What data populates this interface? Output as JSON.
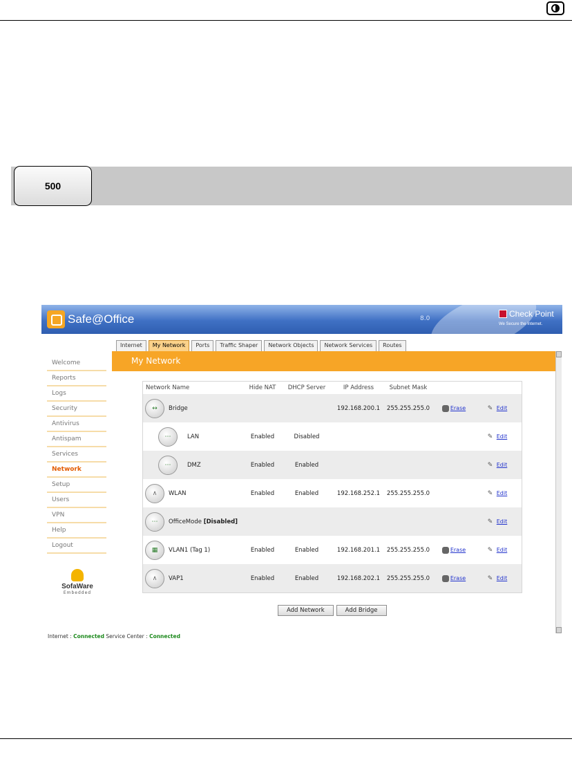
{
  "badge": "500",
  "app": {
    "logo_text": "Safe@Office",
    "version": "8.0",
    "checkpoint_name": "Check Point",
    "checkpoint_tagline": "We Secure the Internet."
  },
  "sidebar": {
    "items": [
      {
        "label": "Welcome"
      },
      {
        "label": "Reports"
      },
      {
        "label": "Logs"
      },
      {
        "label": "Security"
      },
      {
        "label": "Antivirus"
      },
      {
        "label": "Antispam"
      },
      {
        "label": "Services"
      },
      {
        "label": "Network",
        "active": true
      },
      {
        "label": "Setup"
      },
      {
        "label": "Users"
      },
      {
        "label": "VPN"
      },
      {
        "label": "Help"
      },
      {
        "label": "Logout"
      }
    ],
    "brand": "SofaWare",
    "brand_sub": "Embedded"
  },
  "tabs": [
    "Internet",
    "My Network",
    "Ports",
    "Traffic Shaper",
    "Network Objects",
    "Network Services",
    "Routes"
  ],
  "active_tab": "My Network",
  "page_title": "My Network",
  "table": {
    "headers": {
      "name": "Network Name",
      "nat": "Hide NAT",
      "dhcp": "DHCP Server",
      "ip": "IP Address",
      "mask": "Subnet Mask"
    },
    "rows": [
      {
        "name": "Bridge",
        "nat": "",
        "dhcp": "",
        "ip": "192.168.200.1",
        "mask": "255.255.255.0",
        "erase": "Erase",
        "edit": "Edit"
      },
      {
        "name": "LAN",
        "nat": "Enabled",
        "dhcp": "Disabled",
        "ip": "",
        "mask": "",
        "erase": "",
        "edit": "Edit"
      },
      {
        "name": "DMZ",
        "nat": "Enabled",
        "dhcp": "Enabled",
        "ip": "",
        "mask": "",
        "erase": "",
        "edit": "Edit"
      },
      {
        "name": "WLAN",
        "nat": "Enabled",
        "dhcp": "Enabled",
        "ip": "192.168.252.1",
        "mask": "255.255.255.0",
        "erase": "",
        "edit": "Edit"
      },
      {
        "name": "OfficeMode",
        "status": "[Disabled]",
        "nat": "",
        "dhcp": "",
        "ip": "",
        "mask": "",
        "erase": "",
        "edit": "Edit"
      },
      {
        "name": "VLAN1 (Tag 1)",
        "nat": "Enabled",
        "dhcp": "Enabled",
        "ip": "192.168.201.1",
        "mask": "255.255.255.0",
        "erase": "Erase",
        "edit": "Edit"
      },
      {
        "name": "VAP1",
        "nat": "Enabled",
        "dhcp": "Enabled",
        "ip": "192.168.202.1",
        "mask": "255.255.255.0",
        "erase": "Erase",
        "edit": "Edit"
      }
    ]
  },
  "buttons": {
    "add_network": "Add Network",
    "add_bridge": "Add Bridge"
  },
  "status_bar": {
    "internet_label": "Internet :",
    "internet_value": "Connected",
    "service_label": "Service Center :",
    "service_value": "Connected"
  }
}
